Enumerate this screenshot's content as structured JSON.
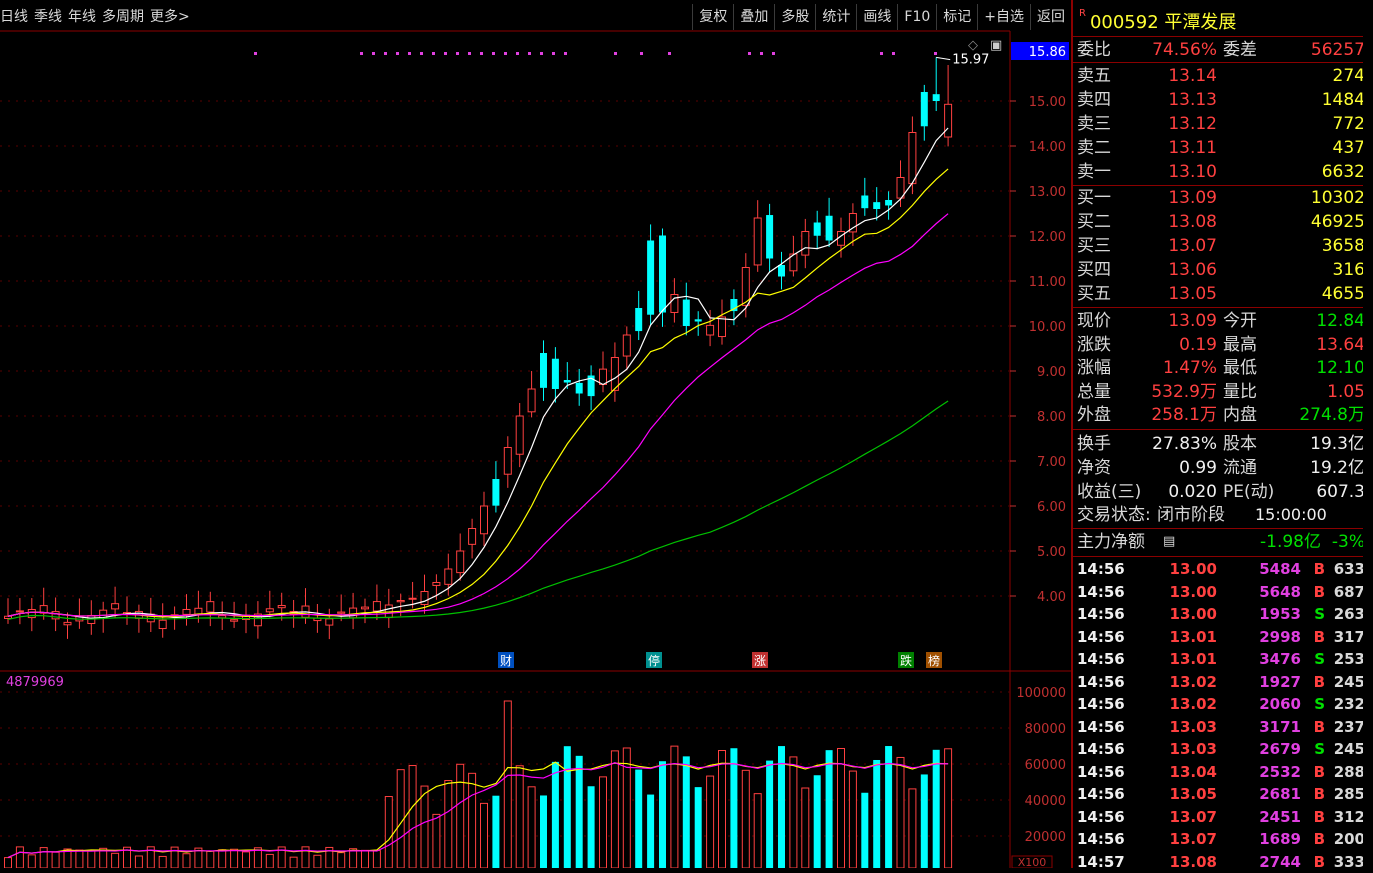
{
  "toolbar_left": [
    "日线",
    "季线",
    "年线",
    "多周期",
    "更多>"
  ],
  "toolbar_right": [
    "复权",
    "叠加",
    "多股",
    "统计",
    "画线",
    "F10",
    "标记",
    "+自选",
    "返回"
  ],
  "stock": {
    "prefix": "R",
    "code": "000592",
    "name": "平潭发展"
  },
  "order_book": {
    "weibi_label": "委比",
    "weibi": "74.56%",
    "weicha_label": "委差",
    "weicha": "56257",
    "asks": [
      {
        "label": "卖五",
        "price": "13.14",
        "vol": "274"
      },
      {
        "label": "卖四",
        "price": "13.13",
        "vol": "1484"
      },
      {
        "label": "卖三",
        "price": "13.12",
        "vol": "772"
      },
      {
        "label": "卖二",
        "price": "13.11",
        "vol": "437"
      },
      {
        "label": "卖一",
        "price": "13.10",
        "vol": "6632"
      }
    ],
    "bids": [
      {
        "label": "买一",
        "price": "13.09",
        "vol": "10302"
      },
      {
        "label": "买二",
        "price": "13.08",
        "vol": "46925"
      },
      {
        "label": "买三",
        "price": "13.07",
        "vol": "3658"
      },
      {
        "label": "买四",
        "price": "13.06",
        "vol": "316"
      },
      {
        "label": "买五",
        "price": "13.05",
        "vol": "4655"
      }
    ]
  },
  "quote": [
    {
      "l1": "现价",
      "v1": "13.09",
      "l2": "今开",
      "v2": "12.84"
    },
    {
      "l1": "涨跌",
      "v1": "0.19",
      "l2": "最高",
      "v2": "13.64"
    },
    {
      "l1": "涨幅",
      "v1": "1.47%",
      "l2": "最低",
      "v2": "12.10"
    },
    {
      "l1": "总量",
      "v1": "532.9万",
      "l2": "量比",
      "v2": "1.05"
    },
    {
      "l1": "外盘",
      "v1": "258.1万",
      "l2": "内盘",
      "v2": "274.8万"
    }
  ],
  "fundamentals": [
    {
      "l1": "换手",
      "v1": "27.83%",
      "l2": "股本",
      "v2": "19.3亿"
    },
    {
      "l1": "净资",
      "v1": "0.99",
      "l2": "流通",
      "v2": "19.2亿"
    },
    {
      "l1": "收益(三)",
      "v1": "0.020",
      "l2": "PE(动)",
      "v2": "607.3"
    }
  ],
  "status": {
    "label": "交易状态:",
    "value": "闭市阶段",
    "time": "15:00:00"
  },
  "main_flow": {
    "label": "主力净额",
    "value": "-1.98亿",
    "pct": "-3%"
  },
  "ticks": [
    {
      "t": "14:56",
      "p": "13.00",
      "v": "5484",
      "bs": "B",
      "n": "633"
    },
    {
      "t": "14:56",
      "p": "13.00",
      "v": "5648",
      "bs": "B",
      "n": "687"
    },
    {
      "t": "14:56",
      "p": "13.00",
      "v": "1953",
      "bs": "S",
      "n": "263"
    },
    {
      "t": "14:56",
      "p": "13.01",
      "v": "2998",
      "bs": "B",
      "n": "317"
    },
    {
      "t": "14:56",
      "p": "13.01",
      "v": "3476",
      "bs": "S",
      "n": "253"
    },
    {
      "t": "14:56",
      "p": "13.02",
      "v": "1927",
      "bs": "B",
      "n": "245"
    },
    {
      "t": "14:56",
      "p": "13.02",
      "v": "2060",
      "bs": "S",
      "n": "232"
    },
    {
      "t": "14:56",
      "p": "13.03",
      "v": "3171",
      "bs": "B",
      "n": "237"
    },
    {
      "t": "14:56",
      "p": "13.03",
      "v": "2679",
      "bs": "S",
      "n": "245"
    },
    {
      "t": "14:56",
      "p": "13.04",
      "v": "2532",
      "bs": "B",
      "n": "288"
    },
    {
      "t": "14:56",
      "p": "13.05",
      "v": "2681",
      "bs": "B",
      "n": "285"
    },
    {
      "t": "14:56",
      "p": "13.07",
      "v": "2451",
      "bs": "B",
      "n": "312"
    },
    {
      "t": "14:56",
      "p": "13.07",
      "v": "1689",
      "bs": "B",
      "n": "200"
    },
    {
      "t": "14:57",
      "p": "13.08",
      "v": "2744",
      "bs": "B",
      "n": "333"
    }
  ],
  "chart": {
    "price_ticks": [
      "15.00",
      "14.00",
      "13.00",
      "12.00",
      "11.00",
      "10.00",
      "9.00",
      "8.00",
      "7.00",
      "6.00",
      "5.00",
      "4.00"
    ],
    "current_price_tag": "15.86",
    "high_label": "15.97",
    "vol_ticks": [
      "100000",
      "80000",
      "60000",
      "40000",
      "20000"
    ],
    "vol_unit": "X100",
    "vol_readout": "4879969",
    "event_badges": [
      "财",
      "停",
      "涨",
      "跌",
      "榜"
    ]
  }
}
